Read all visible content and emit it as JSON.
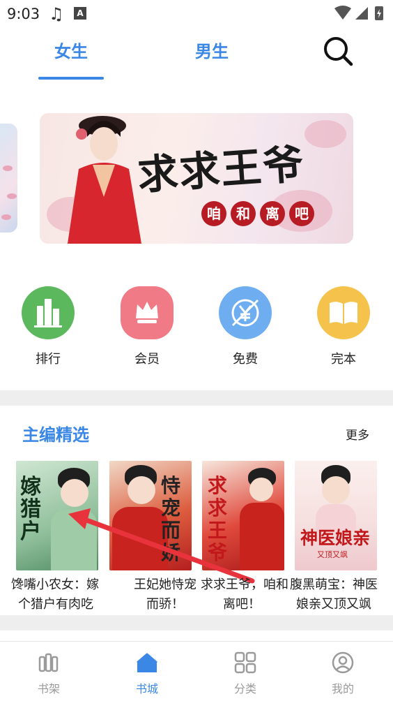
{
  "status_bar": {
    "time": "9:03",
    "ime_badge": "A",
    "icons": [
      "music-icon",
      "keyboard-icon",
      "wifi-icon",
      "signal-icon",
      "battery-icon"
    ]
  },
  "tabs": [
    {
      "label": "女生",
      "active": true
    },
    {
      "label": "男生",
      "active": false
    }
  ],
  "banner": {
    "title": "求求王爷",
    "subtitle": [
      "咱",
      "和",
      "离",
      "吧"
    ]
  },
  "categories": [
    {
      "label": "排行",
      "icon": "ranking-icon",
      "color": "#5cb85c"
    },
    {
      "label": "会员",
      "icon": "crown-icon",
      "color": "#f07b86"
    },
    {
      "label": "免费",
      "icon": "yen-free-icon",
      "color": "#6eaef0"
    },
    {
      "label": "完本",
      "icon": "open-book-icon",
      "color": "#f5c24b"
    }
  ],
  "section": {
    "title": "主编精选",
    "more": "更多"
  },
  "books": [
    {
      "cover_text": "嫁猎户",
      "name_line1": "馋嘴小农女：嫁",
      "name_line2": "个猎户有肉吃"
    },
    {
      "cover_text": "恃宠而娇",
      "name_line1": "王妃她恃宠",
      "name_line2": "而骄！"
    },
    {
      "cover_text": "求求王爷",
      "name_line1": "求求王爷，咱和",
      "name_line2": "离吧！"
    },
    {
      "cover_text": "神医娘亲",
      "cover_sub": "又顶又飒",
      "name_line1": "腹黑萌宝：神医",
      "name_line2": "娘亲又顶又飒"
    }
  ],
  "bottom_nav": [
    {
      "label": "书架",
      "icon": "bookshelf-icon",
      "active": false
    },
    {
      "label": "书城",
      "icon": "bookstore-home-icon",
      "active": true
    },
    {
      "label": "分类",
      "icon": "grid-category-icon",
      "active": false
    },
    {
      "label": "我的",
      "icon": "profile-icon",
      "active": false
    }
  ],
  "colors": {
    "accent": "#3a87e6",
    "inactive": "#9a9a9a",
    "annotation_arrow": "#e8323c"
  }
}
